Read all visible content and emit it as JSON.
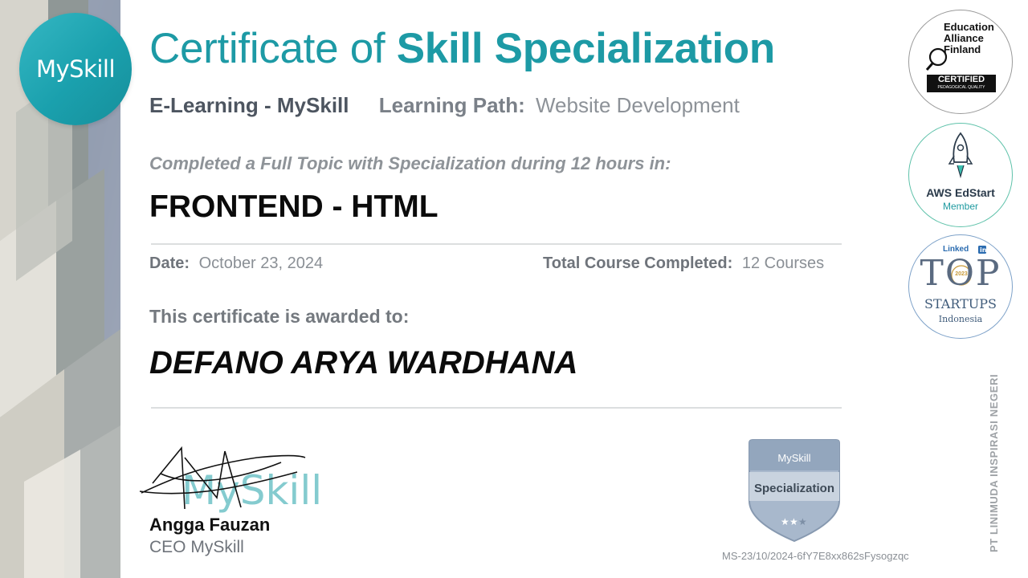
{
  "brand": {
    "logo_text": "MySkill"
  },
  "header": {
    "title_light": "Certificate of",
    "title_bold": "Skill Specialization",
    "organization": "E-Learning - MySkill",
    "learning_path_label": "Learning Path:",
    "learning_path_value": "Website Development"
  },
  "completion": {
    "statement": "Completed a Full Topic with Specialization during 12 hours in:",
    "course_title": "FRONTEND - HTML",
    "date_label": "Date:",
    "date_value": "October 23, 2024",
    "total_label": "Total Course Completed:",
    "total_value": "12 Courses"
  },
  "award": {
    "statement": "This certificate is awarded to:",
    "recipient": "DEFANO ARYA WARDHANA"
  },
  "signatory": {
    "signature_text": "MySkill",
    "name": "Angga Fauzan",
    "title": "CEO MySkill"
  },
  "badge": {
    "brand": "MySkill",
    "label": "Specialization",
    "stars_filled": 2,
    "stars_total": 3
  },
  "certificate_id": "MS-23/10/2024-6fY7E8xx862sFysogzqc",
  "seals": {
    "education_alliance": {
      "name_lines": [
        "Education",
        "Alliance",
        "Finland"
      ],
      "certified": "CERTIFIED",
      "quality": "PEDAGOGICAL QUALITY"
    },
    "aws": {
      "name": "AWS EdStart",
      "member": "Member"
    },
    "linkedin_top": {
      "brand": "Linked",
      "top": "TOP",
      "year": "2023",
      "startups": "STARTUPS",
      "country": "Indonesia"
    }
  },
  "company_vertical": "PT LINIMUDA INSPIRASI NEGERI",
  "colors": {
    "teal": "#1d9aa5",
    "dark_text": "#0b0b0b",
    "gray_text": "#7a8088"
  }
}
